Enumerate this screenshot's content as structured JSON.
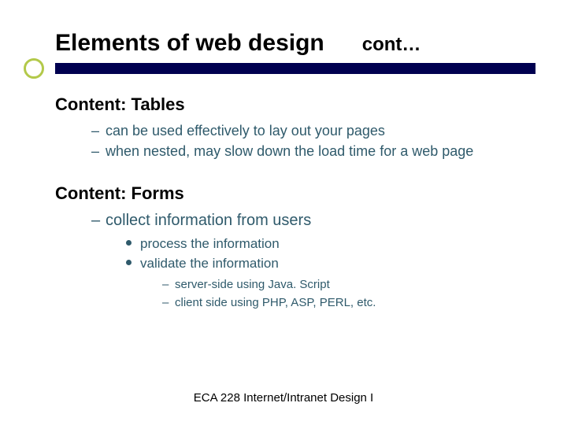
{
  "title_main": "Elements of web design",
  "title_cont": "cont…",
  "sections": [
    {
      "heading": "Content: Tables",
      "bullets": [
        "can be used effectively to lay out your pages",
        "when nested, may slow down the load time for a web page"
      ]
    },
    {
      "heading": "Content: Forms",
      "bullets_top": [
        "collect information from users"
      ],
      "sub_bullets": [
        "process the information",
        "validate the information"
      ],
      "sub_sub": [
        "server-side using Java. Script",
        "client side using PHP, ASP, PERL, etc."
      ]
    }
  ],
  "footer": "ECA 228  Internet/Intranet Design I",
  "colors": {
    "dark_bar": "#000050",
    "ring": "#B3C94A",
    "body_text": "#2F5A6B"
  }
}
